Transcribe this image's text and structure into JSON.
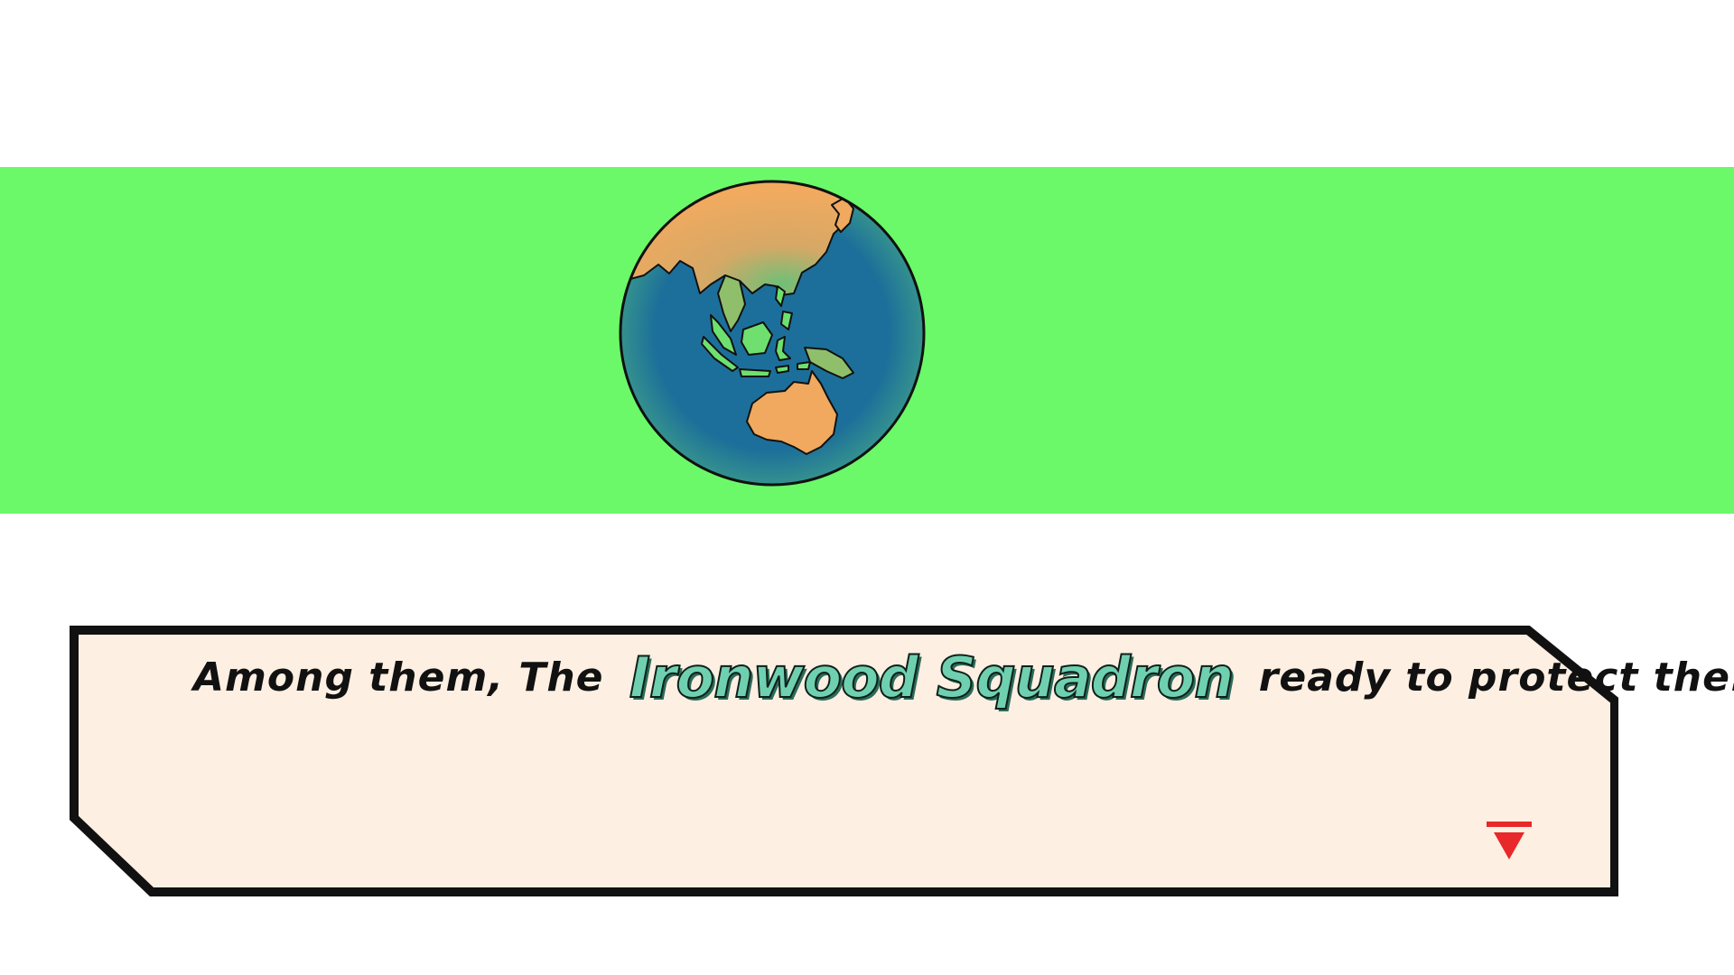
{
  "scene": {
    "band_color": "#6bf969",
    "background_color": "#ffffff"
  },
  "globe": {
    "icon": "earth-globe-icon",
    "ocean_color": "#1c6f9a",
    "land_color": "#f0a95e",
    "island_color": "#6fe06f"
  },
  "dialog": {
    "text_before": "Among them, The",
    "highlight_name": "Ironwood Squadron",
    "text_after": "ready to protect the...",
    "name_color": "#6fd0b0",
    "box_fill": "#fdefe2",
    "border_color": "#111111",
    "advance_icon": "advance-arrow-icon",
    "advance_color": "#e8282a"
  }
}
